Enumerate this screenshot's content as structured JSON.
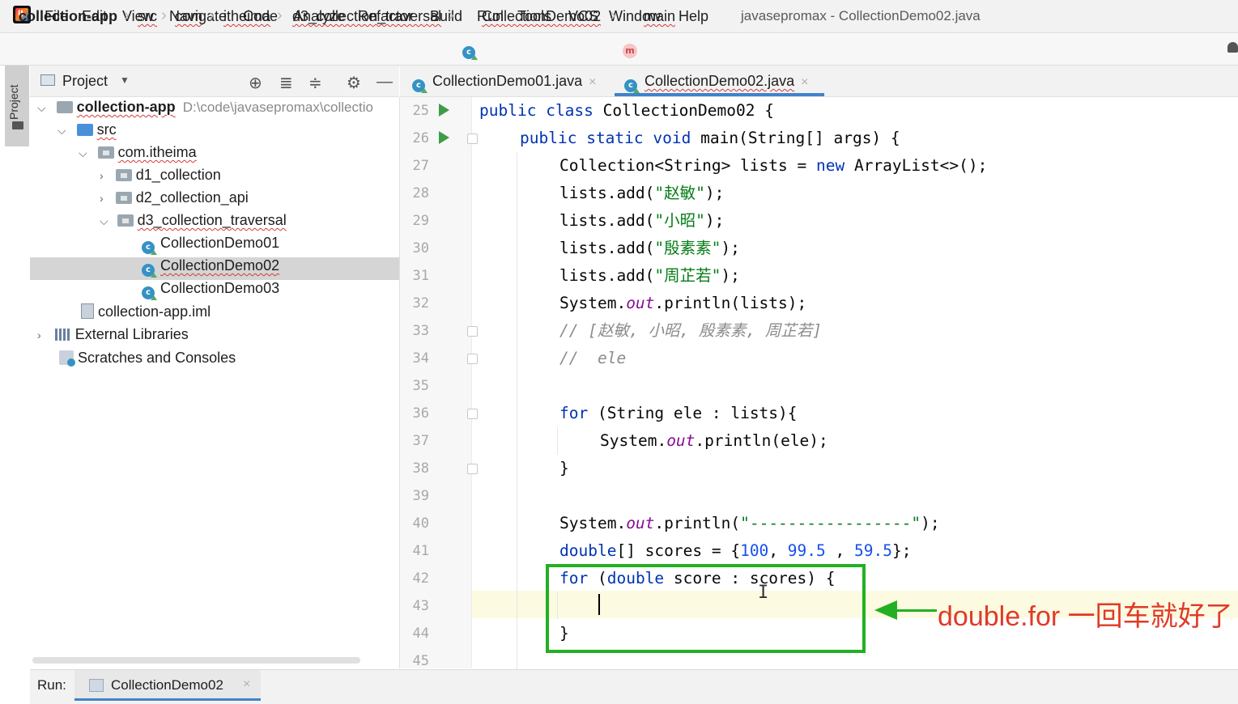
{
  "menubar": {
    "items": [
      "File",
      "Edit",
      "View",
      "Navigate",
      "Code",
      "Analyze",
      "Refactor",
      "Build",
      "Run",
      "Tools",
      "VCS",
      "Window",
      "Help"
    ],
    "window_title": "javasepromax - CollectionDemo02.java"
  },
  "breadcrumb": {
    "items": [
      "collection-app",
      "src",
      "com",
      "itheima",
      "d3_collection_traversal",
      "CollectionDemo02",
      "main"
    ]
  },
  "project_pane": {
    "title": "Project",
    "tree": [
      {
        "label": "collection-app",
        "path": "D:\\code\\javasepromax\\collectio"
      },
      {
        "label": "src"
      },
      {
        "label": "com.itheima"
      },
      {
        "label": "d1_collection"
      },
      {
        "label": "d2_collection_api"
      },
      {
        "label": "d3_collection_traversal"
      },
      {
        "label": "CollectionDemo01"
      },
      {
        "label": "CollectionDemo02"
      },
      {
        "label": "CollectionDemo03"
      },
      {
        "label": "collection-app.iml"
      },
      {
        "label": "External Libraries"
      },
      {
        "label": "Scratches and Consoles"
      }
    ],
    "stripe_label": "Project"
  },
  "tabs": [
    {
      "label": "CollectionDemo01.java",
      "active": false
    },
    {
      "label": "CollectionDemo02.java",
      "active": true
    }
  ],
  "editor": {
    "line_numbers": [
      "25",
      "26",
      "27",
      "28",
      "29",
      "30",
      "31",
      "32",
      "33",
      "34",
      "35",
      "36",
      "37",
      "38",
      "39",
      "40",
      "41",
      "42",
      "43",
      "44",
      "45"
    ],
    "code": {
      "l25": {
        "kw1": "public",
        "kw2": "class",
        "rest": " CollectionDemo02 {"
      },
      "l26": {
        "kw1": "public",
        "kw2": "static",
        "kw3": "void",
        "rest": " main(String[] args) {"
      },
      "l27": {
        "a": "Collection<String> lists = ",
        "kw": "new",
        "b": " ArrayList<>();"
      },
      "l28": {
        "a": "lists.add(",
        "s": "\"赵敏\"",
        "b": ");"
      },
      "l29": {
        "a": "lists.add(",
        "s": "\"小昭\"",
        "b": ");"
      },
      "l30": {
        "a": "lists.add(",
        "s": "\"殷素素\"",
        "b": ");"
      },
      "l31": {
        "a": "lists.add(",
        "s": "\"周芷若\"",
        "b": ");"
      },
      "l32": {
        "a": "System.",
        "f": "out",
        "b": ".println(lists);"
      },
      "l33": {
        "c": "// [赵敏, 小昭, 殷素素, 周芷若]"
      },
      "l34": {
        "c": "//  ele"
      },
      "l36": {
        "kw": "for",
        "b": " (String ele : lists){"
      },
      "l37": {
        "a": "System.",
        "f": "out",
        "b": ".println(ele);"
      },
      "l38": {
        "b": "}"
      },
      "l40": {
        "a": "System.",
        "f": "out",
        "b": ".println(",
        "s": "\"-----------------\"",
        "c": ");"
      },
      "l41": {
        "kw": "double",
        "a": "[] scores = {",
        "n1": "100",
        "sep1": ", ",
        "n2": "99.5",
        "sep2": " , ",
        "n3": "59.5",
        "b": "};"
      },
      "l42": {
        "kw": "for",
        "a": " (",
        "kw2": "double",
        "b": " score : scores) {"
      },
      "l44": {
        "b": "}"
      }
    }
  },
  "annotation": {
    "text": "double.for 一回车就好了",
    "color": "#e03a28",
    "box_color": "#22b022"
  },
  "runbar": {
    "label": "Run:",
    "tab": "CollectionDemo02"
  },
  "icons": {
    "run_gutter": "run-arrow-icon",
    "class": "java-class-icon",
    "method": "method-icon"
  }
}
